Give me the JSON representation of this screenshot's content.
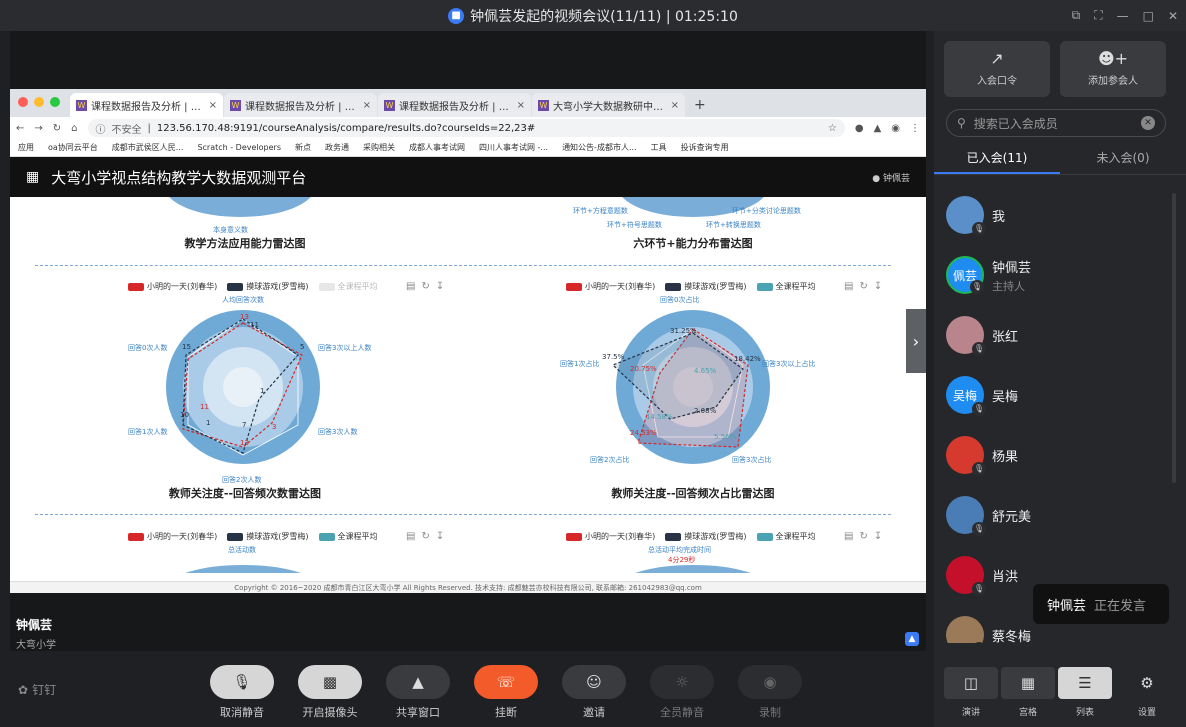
{
  "window": {
    "title": "钟佩芸发起的视频会议(11/11) | 01:25:10"
  },
  "browser": {
    "tabs": [
      {
        "label": "课程数据报告及分析 | 大弯小学",
        "active": true
      },
      {
        "label": "课程数据报告及分析 | 大弯小学",
        "active": false
      },
      {
        "label": "课程数据报告及分析 | 大弯小学",
        "active": false
      },
      {
        "label": "大弯小学大数据教研中心 小组",
        "active": false
      }
    ],
    "insecure": "不安全",
    "url": "123.56.170.48:9191/courseAnalysis/compare/results.do?courseIds=22,23#",
    "bookmarks": [
      "应用",
      "oa协同云平台",
      "成都市武侯区人民...",
      "Scratch - Developers",
      "新点",
      "政务通",
      "采购相关",
      "成都人事考试网",
      "四川人事考试网 -...",
      "通知公告-成都市人...",
      "工具",
      "投诉查询专用"
    ]
  },
  "app": {
    "title": "大弯小学视点结构教学大数据观测平台",
    "user": "钟佩芸",
    "charts_top": [
      {
        "title": "教学方法应用能力雷达图",
        "labels": [
          "本身意义数"
        ]
      },
      {
        "title": "六环节+能力分布雷达图",
        "labels": [
          "环节+方程意题数",
          "环节+分类讨论思题数",
          "环节+符号思题数",
          "环节+转换思题数"
        ]
      }
    ],
    "legend_a": [
      "小明的一天(刘春华)",
      "摸球游戏(罗雪梅)",
      "全课程平均"
    ],
    "chart_left": {
      "title": "教师关注度--回答频次数雷达图",
      "axes": [
        "人均回答次数",
        "回答3次以上人数",
        "回答3次人数",
        "回答2次人数",
        "回答1次人数",
        "回答0次人数"
      ],
      "values_a": [
        "13",
        "5",
        "3",
        "13",
        "11",
        "15"
      ],
      "values_b": [
        "11",
        "1",
        "7",
        "10",
        "1"
      ]
    },
    "chart_right": {
      "title": "教师关注度--回答频次占比雷达图",
      "axes": [
        "回答0次占比",
        "回答3次以上占比",
        "回答3次占比",
        "回答2次占比",
        "回答1次占比"
      ],
      "values": [
        "31.25%",
        "18.42%",
        "4.65%",
        "2.08%",
        "5.56%",
        "24.53%",
        "37.5%",
        "20.75%",
        "14.58%"
      ]
    },
    "bottom_left": {
      "label": "总活动数"
    },
    "bottom_right": {
      "label": "总活动平均完成时间",
      "value": "4分29秒"
    },
    "footer": "Copyright © 2016~2020 成都市青白江区大弯小学 All Rights Reserved. 技术支持: 成都魅芸亦校科技有限公司, 联系邮箱: 261042983@qq.com"
  },
  "speaker": {
    "name": "钟佩芸",
    "org": "大弯小学"
  },
  "controls": [
    {
      "label": "取消静音",
      "icon": "mic-icon",
      "state": "on"
    },
    {
      "label": "开启摄像头",
      "icon": "camera-off-icon",
      "state": "on"
    },
    {
      "label": "共享窗口",
      "icon": "share-icon",
      "state": "normal"
    },
    {
      "label": "挂断",
      "icon": "hangup-icon",
      "state": "hang"
    },
    {
      "label": "邀请",
      "icon": "invite-icon",
      "state": "normal"
    },
    {
      "label": "全员静音",
      "icon": "mute-all-icon",
      "state": "dim"
    },
    {
      "label": "录制",
      "icon": "record-icon",
      "state": "dim"
    }
  ],
  "dingtalk": "钉钉",
  "panel": {
    "join_code": "入会口令",
    "add_member": "添加参会人",
    "search_placeholder": "搜索已入会成员",
    "tab_joined": "已入会(11)",
    "tab_not_joined": "未入会(0)",
    "participants": [
      {
        "name": "我",
        "role": "",
        "avatar_text": "",
        "color": "#5b8fc9"
      },
      {
        "name": "钟佩芸",
        "role": "主持人",
        "avatar_text": "佩芸",
        "color": "#1e8cf0"
      },
      {
        "name": "张红",
        "role": "",
        "avatar_text": "",
        "color": "#b9848c"
      },
      {
        "name": "吴梅",
        "role": "",
        "avatar_text": "吴梅",
        "color": "#1e8cf0"
      },
      {
        "name": "杨果",
        "role": "",
        "avatar_text": "",
        "color": "#d63a2f"
      },
      {
        "name": "舒元美",
        "role": "",
        "avatar_text": "",
        "color": "#4a7db5"
      },
      {
        "name": "肖洪",
        "role": "",
        "avatar_text": "",
        "color": "#c4102a"
      },
      {
        "name": "蔡冬梅",
        "role": "",
        "avatar_text": "",
        "color": "#9a7a58"
      }
    ],
    "view_buttons": [
      {
        "label": "演讲",
        "active": false
      },
      {
        "label": "宫格",
        "active": false
      },
      {
        "label": "列表",
        "active": true
      }
    ],
    "settings": "设置"
  },
  "toast": {
    "name": "钟佩芸",
    "status": "正在发言"
  }
}
